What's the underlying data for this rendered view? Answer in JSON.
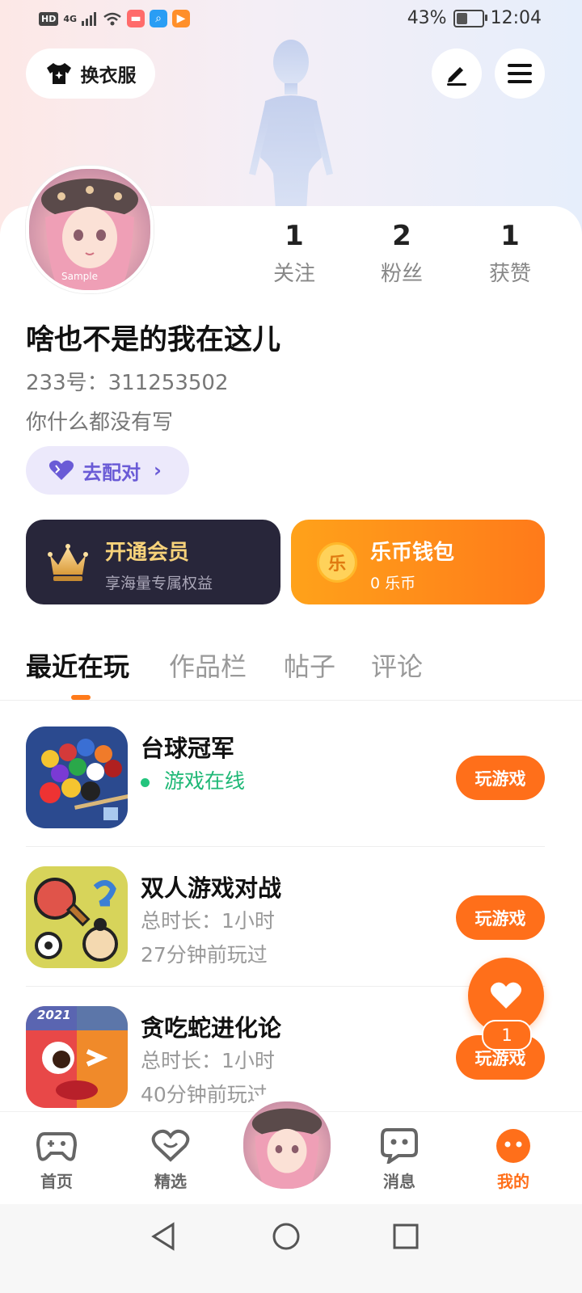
{
  "status_bar": {
    "hd": "HD",
    "network": "4G",
    "battery": "43%",
    "battery_level": 0.43,
    "time": "12:04"
  },
  "header": {
    "dress_label": "换衣服",
    "dress_icon": "tshirt-icon",
    "edit_icon": "pen-icon",
    "menu_icon": "hamburger-menu-icon"
  },
  "profile": {
    "avatar_watermark": "Sample",
    "stats": [
      {
        "value": "1",
        "label": "关注"
      },
      {
        "value": "2",
        "label": "粉丝"
      },
      {
        "value": "1",
        "label": "获赞"
      }
    ],
    "nickname": "啥也不是的我在这儿",
    "uid": "233号：311253502",
    "bio": "你什么都没有写",
    "match_label": "去配对"
  },
  "cards": {
    "vip_title": "开通会员",
    "vip_sub": "享海量专属权益",
    "wallet_title": "乐币钱包",
    "wallet_sub": "0 乐币",
    "wallet_coin_char": "乐"
  },
  "tabs": [
    "最近在玩",
    "作品栏",
    "帖子",
    "评论"
  ],
  "games": [
    {
      "name": "台球冠军",
      "line1": "游戏在线",
      "line2": "",
      "action": "玩游戏"
    },
    {
      "name": "双人游戏对战",
      "line1": "总时长：1小时",
      "line2": "27分钟前玩过",
      "action": "玩游戏"
    },
    {
      "name": "贪吃蛇进化论",
      "line1": "总时长：1小时",
      "line2": "40分钟前玩过",
      "action": "玩游戏"
    }
  ],
  "game3_badge": "2021",
  "fab_badge": "1",
  "bottom_nav": [
    {
      "label": "首页",
      "icon": "gamepad-icon"
    },
    {
      "label": "精选",
      "icon": "heart-icon"
    },
    {
      "label": "消息",
      "icon": "chat-icon"
    },
    {
      "label": "我的",
      "icon": "smiley-icon"
    }
  ],
  "colors": {
    "accent": "#ff6f1a",
    "online": "#1fb876",
    "match": "#6a5bd6",
    "vip_bg": "#28263a"
  }
}
